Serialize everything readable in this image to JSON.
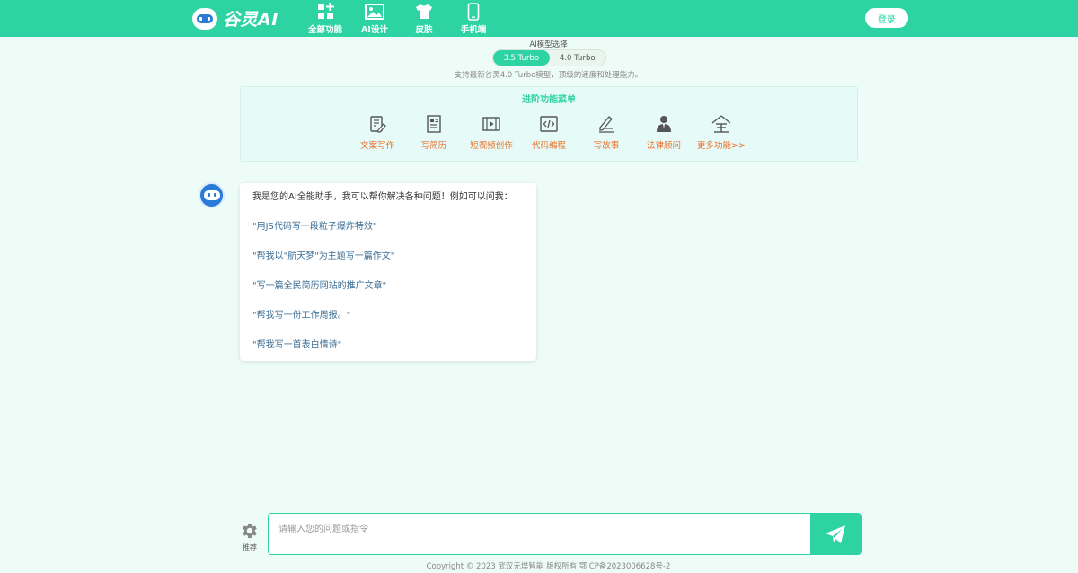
{
  "header": {
    "logo_text": "谷灵AI",
    "nav": [
      {
        "label": "全部功能",
        "icon": "grid-plus-icon"
      },
      {
        "label": "AI设计",
        "icon": "image-icon"
      },
      {
        "label": "皮肤",
        "icon": "tshirt-icon"
      },
      {
        "label": "手机端",
        "icon": "mobile-icon"
      }
    ],
    "login_label": "登录"
  },
  "model": {
    "title": "AI模型选择",
    "options": [
      "3.5 Turbo",
      "4.0 Turbo"
    ],
    "selected": "3.5 Turbo",
    "description": "支持最新谷灵4.0 Turbo模型，顶级的速度和处理能力。"
  },
  "advanced_menu": {
    "title": "进阶功能菜单",
    "items": [
      {
        "label": "文案写作",
        "icon": "edit-document-icon"
      },
      {
        "label": "写简历",
        "icon": "resume-icon"
      },
      {
        "label": "短视频创作",
        "icon": "video-icon"
      },
      {
        "label": "代码编程",
        "icon": "code-icon"
      },
      {
        "label": "写故事",
        "icon": "pen-writing-icon"
      },
      {
        "label": "法律顾问",
        "icon": "lawyer-icon"
      },
      {
        "label": "更多功能>>",
        "icon": "all-icon"
      }
    ]
  },
  "chat": {
    "intro": "我是您的AI全能助手，我可以帮你解决各种问题！例如可以问我：",
    "suggestions": [
      "\"用JS代码写一段粒子爆炸特效\"",
      "\"帮我以\"航天梦\"为主题写一篇作文\"",
      "\"写一篇全民简历网站的推广文章\"",
      "\"帮我写一份工作周报。\"",
      "\"帮我写一首表白情诗\""
    ]
  },
  "input": {
    "placeholder": "请输入您的问题或指令",
    "recommend_label": "推荐"
  },
  "footer": {
    "text": "Copyright © 2023 武汉元堞智能 版权所有 鄂ICP备2023006628号-2"
  },
  "colors": {
    "brand": "#2ed3a4",
    "accent_orange": "#e8712a",
    "link_blue": "#3d6f96"
  }
}
